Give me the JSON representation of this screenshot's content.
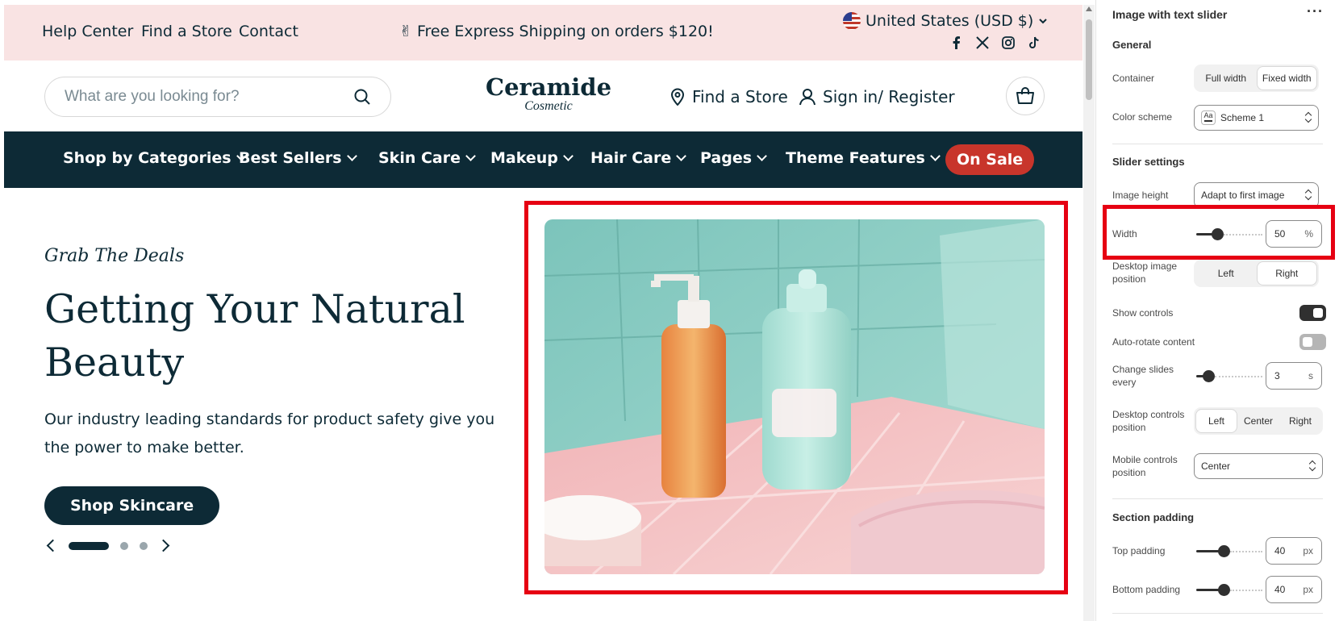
{
  "topbar": {
    "links": [
      "Help Center",
      "Find a Store",
      "Contact"
    ],
    "promo": "✌ Free Express Shipping on orders $120!",
    "locale": "United States (USD $)",
    "socials": [
      "facebook-icon",
      "x-icon",
      "instagram-icon",
      "tiktok-icon"
    ]
  },
  "header": {
    "search_placeholder": "What are you looking for?",
    "logo_main": "Ceramide",
    "logo_sub": "Cosmetic",
    "find_store": "Find a Store",
    "sign_in": "Sign in/ Register"
  },
  "nav": {
    "items": [
      "Shop by Categories",
      "Best Sellers",
      "Skin Care",
      "Makeup",
      "Hair Care",
      "Pages",
      "Theme Features"
    ],
    "sale": "On Sale"
  },
  "hero": {
    "subtitle": "Grab The Deals",
    "title": "Getting Your Natural Beauty",
    "text": "Our industry leading standards for product safety give you the power to make better.",
    "button": "Shop Skincare",
    "slides_total": 3,
    "active_slide": 1
  },
  "panel": {
    "title": "Image with text slider",
    "more": "···",
    "general": "General",
    "container_label": "Container",
    "container_options": [
      "Full width",
      "Fixed width"
    ],
    "container_selected": "Fixed width",
    "color_scheme_label": "Color scheme",
    "color_scheme_icon": "Aa",
    "color_scheme_value": "Scheme 1",
    "slider_settings": "Slider settings",
    "image_height_label": "Image height",
    "image_height_value": "Adapt to first image",
    "width_label": "Width",
    "width_value": "50",
    "width_unit": "%",
    "width_fraction": 0.29,
    "desktop_image_position_label": "Desktop image position",
    "desktop_image_position_options": [
      "Left",
      "Right"
    ],
    "desktop_image_position_selected": "Right",
    "show_controls_label": "Show controls",
    "show_controls": true,
    "auto_rotate_label": "Auto-rotate content",
    "auto_rotate": false,
    "change_slides_label": "Change slides every",
    "change_slides_value": "3",
    "change_slides_unit": "s",
    "change_slides_fraction": 0.12,
    "desktop_controls_position_label": "Desktop controls position",
    "desktop_controls_position_options": [
      "Left",
      "Center",
      "Right"
    ],
    "desktop_controls_position_selected": "Left",
    "mobile_controls_position_label": "Mobile controls position",
    "mobile_controls_position_value": "Center",
    "section_padding": "Section padding",
    "top_padding_label": "Top padding",
    "top_padding_value": "40",
    "top_padding_unit": "px",
    "top_padding_fraction": 0.4,
    "bottom_padding_label": "Bottom padding",
    "bottom_padding_value": "40",
    "bottom_padding_unit": "px",
    "bottom_padding_fraction": 0.4
  },
  "colors": {
    "brand_dark": "#0d2a36",
    "topbar_bg": "#f9e3e3",
    "sale": "#c8352b",
    "highlight": "#e60012"
  }
}
